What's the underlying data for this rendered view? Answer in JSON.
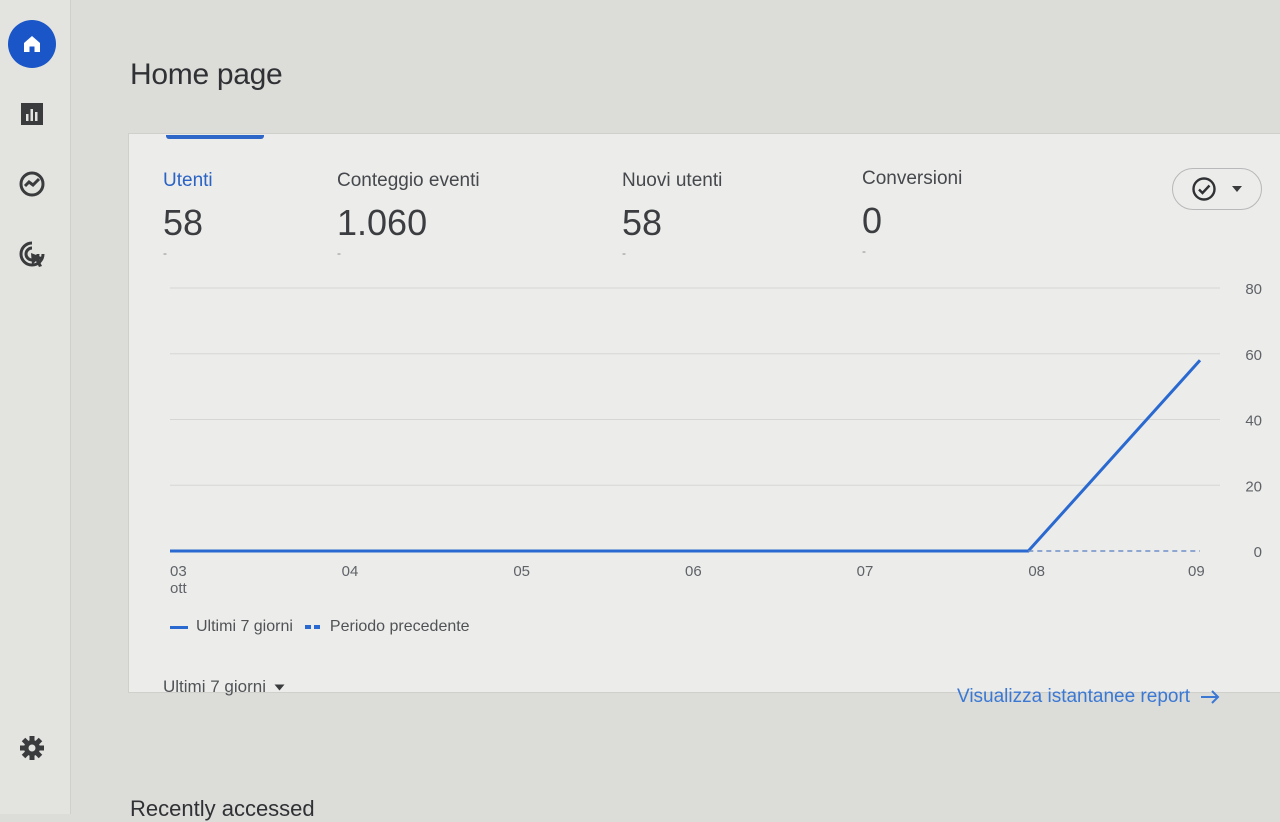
{
  "page": {
    "title": "Home page"
  },
  "nav": {
    "items": [
      {
        "id": "home",
        "icon": "home-icon"
      },
      {
        "id": "reports",
        "icon": "bar-chart-icon"
      },
      {
        "id": "explore",
        "icon": "explore-icon"
      },
      {
        "id": "advertising",
        "icon": "advertising-icon"
      },
      {
        "id": "settings",
        "icon": "gear-icon"
      }
    ],
    "active_color": "#1a56c7"
  },
  "metrics": [
    {
      "label": "Utenti",
      "value": "58",
      "delta": "-",
      "active": true
    },
    {
      "label": "Conteggio eventi",
      "value": "1.060",
      "delta": "-"
    },
    {
      "label": "Nuovi utenti",
      "value": "58",
      "delta": "-"
    },
    {
      "label": "Conversioni",
      "value": "0",
      "delta": "-"
    }
  ],
  "compare_button": {
    "icon": "check-circle-icon",
    "dropdown_icon": "caret-down-icon"
  },
  "chart_data": {
    "type": "line",
    "x": [
      "03",
      "04",
      "05",
      "06",
      "07",
      "08",
      "09"
    ],
    "x_sublabels": [
      "ott",
      "",
      "",
      "",
      "",
      "",
      ""
    ],
    "series": [
      {
        "name": "Ultimi 7 giorni",
        "values": [
          0,
          0,
          0,
          0,
          0,
          0,
          58
        ],
        "style": "solid",
        "color": "#2a6ad0"
      },
      {
        "name": "Periodo precedente",
        "values": [
          null,
          null,
          null,
          null,
          null,
          0,
          0
        ],
        "style": "dashed",
        "color": "#2a6ad0"
      }
    ],
    "y_ticks": [
      0,
      20,
      40,
      60,
      80
    ],
    "ylim": [
      0,
      80
    ],
    "y_axis_side": "right",
    "grid": true,
    "legend": "bottom-left"
  },
  "date_range": {
    "label": "Ultimi 7 giorni"
  },
  "snapshot_link": {
    "label": "Visualizza istantanee report"
  },
  "recent": {
    "title": "Recently accessed"
  }
}
